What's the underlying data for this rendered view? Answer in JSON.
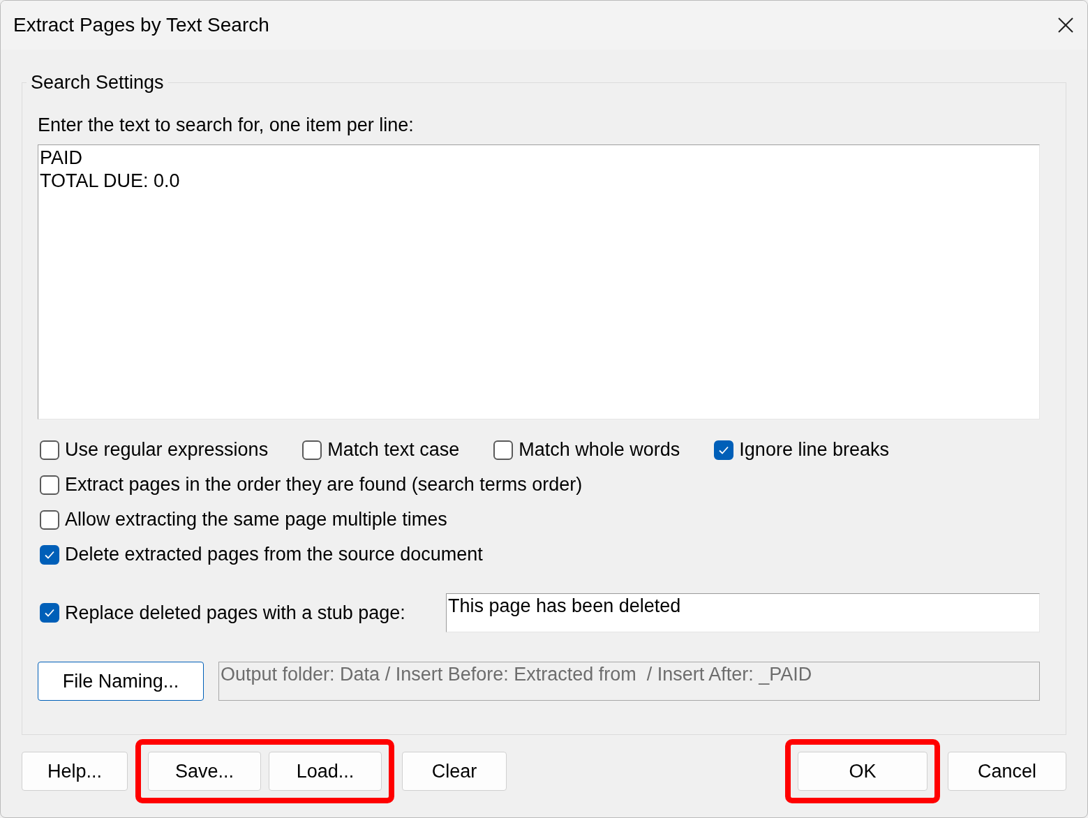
{
  "window": {
    "title": "Extract Pages by Text Search"
  },
  "group": {
    "title": "Search Settings",
    "prompt": "Enter the text to search for, one item per line:",
    "search_text": "PAID\nTOTAL DUE: 0.0"
  },
  "option_rows": [
    [
      {
        "label": "Use regular expressions",
        "checked": false
      },
      {
        "label": "Match text case",
        "checked": false
      },
      {
        "label": "Match whole words",
        "checked": false
      },
      {
        "label": "Ignore line breaks",
        "checked": true
      }
    ],
    [
      {
        "label": "Extract pages in the order they are found (search terms order)",
        "checked": false
      }
    ],
    [
      {
        "label": "Allow extracting the same page multiple times",
        "checked": false
      }
    ],
    [
      {
        "label": "Delete extracted pages from the source document",
        "checked": true
      }
    ]
  ],
  "stub": {
    "label": "Replace deleted pages with a stub page:",
    "checked": true,
    "value": "This page has been deleted"
  },
  "file_naming": {
    "button": "File Naming...",
    "summary": "Output folder: Data / Insert Before: Extracted from  / Insert After: _PAID",
    "disabled": true
  },
  "buttons": [
    {
      "label": "Help...",
      "highlighted": false
    },
    {
      "label": "Save...",
      "highlighted": true
    },
    {
      "label": "Load...",
      "highlighted": true
    },
    {
      "label": "Clear",
      "highlighted": false
    },
    {
      "label": "OK",
      "highlighted": true
    },
    {
      "label": "Cancel",
      "highlighted": false
    }
  ]
}
